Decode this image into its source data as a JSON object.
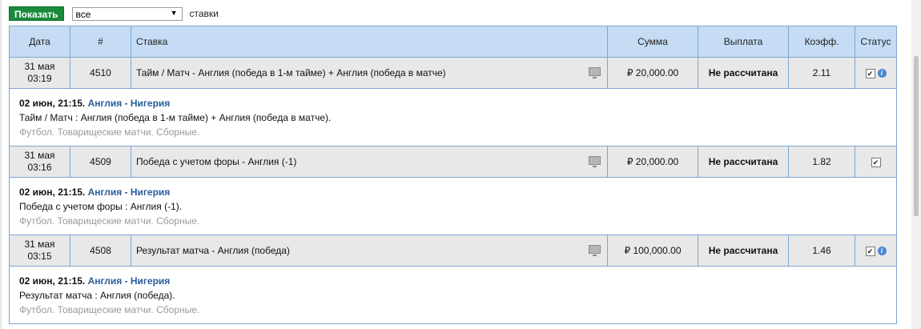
{
  "toolbar": {
    "show_button": "Показать",
    "filter_value": "все",
    "filter_label": "ставки"
  },
  "table": {
    "headers": {
      "date": "Дата",
      "number": "#",
      "bet": "Ставка",
      "amount": "Сумма",
      "payout": "Выплата",
      "odds": "Коэфф.",
      "status": "Статус"
    },
    "bets": [
      {
        "date": "31 мая",
        "time": "03:19",
        "number": "4510",
        "description": "Тайм / Матч - Англия (победа в 1-м тайме) + Англия (победа в матче)",
        "amount": "₽ 20,000.00",
        "payout": "Не рассчитана",
        "odds": "2.11",
        "has_info": true,
        "event_when": "02 июн, 21:15.",
        "event_match": "Англия - Нигерия",
        "event_selection": "Тайм / Матч : Англия (победа в 1-м тайме) + Англия (победа в матче).",
        "event_league": "Футбол. Товарищеские матчи. Сборные."
      },
      {
        "date": "31 мая",
        "time": "03:16",
        "number": "4509",
        "description": "Победа с учетом форы - Англия (-1)",
        "amount": "₽ 20,000.00",
        "payout": "Не рассчитана",
        "odds": "1.82",
        "has_info": false,
        "event_when": "02 июн, 21:15.",
        "event_match": "Англия - Нигерия",
        "event_selection": "Победа с учетом форы : Англия (-1).",
        "event_league": "Футбол. Товарищеские матчи. Сборные."
      },
      {
        "date": "31 мая",
        "time": "03:15",
        "number": "4508",
        "description": "Результат матча - Англия (победа)",
        "amount": "₽ 100,000.00",
        "payout": "Не рассчитана",
        "odds": "1.46",
        "has_info": true,
        "event_when": "02 июн, 21:15.",
        "event_match": "Англия - Нигерия",
        "event_selection": "Результат матча : Англия (победа).",
        "event_league": "Футбол. Товарищеские матчи. Сборные."
      }
    ]
  },
  "icons": {
    "tv": "tv-icon",
    "checkbox": "checkbox-icon",
    "info": "info-icon"
  },
  "colors": {
    "show_button": "#1a8a3b",
    "header_bg": "#c5dcf4",
    "row_bg": "#e8e8e8",
    "match_link": "#2a5d9c",
    "league_text": "#9a9a9a"
  }
}
